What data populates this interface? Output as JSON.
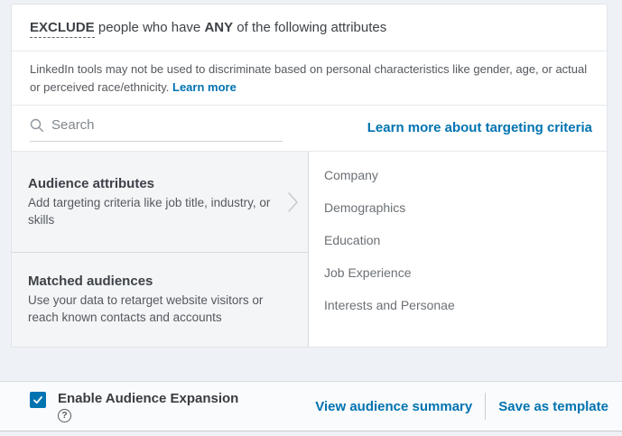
{
  "exclude_header": {
    "exclude": "EXCLUDE",
    "text_mid": " people who have ",
    "any": "ANY",
    "text_end": " of the following attributes"
  },
  "disclaimer": {
    "text": "LinkedIn tools may not be used to discriminate based on personal characteristics like gender, age, or actual or perceived race/ethnicity. ",
    "link": "Learn more"
  },
  "search": {
    "placeholder": "Search",
    "icon": "search-icon"
  },
  "targeting_link": "Learn more about targeting criteria",
  "panels": [
    {
      "title": "Audience attributes",
      "description": "Add targeting criteria like job title, industry, or skills",
      "icon": "chevron-right-icon"
    },
    {
      "title": "Matched audiences",
      "description": "Use your data to retarget website visitors or reach known contacts and accounts"
    }
  ],
  "categories": [
    "Company",
    "Demographics",
    "Education",
    "Job Experience",
    "Interests and Personae"
  ],
  "footer": {
    "checkbox_checked": true,
    "checkbox_label": "Enable Audience Expansion",
    "help_icon": "help-icon",
    "links": [
      "View audience summary",
      "Save as template"
    ]
  },
  "colors": {
    "link_blue": "#0073b1",
    "checkbox_blue": "#0073b1",
    "left_panel_bg": "#f3f5f7",
    "footer_bg": "#fafbfc"
  }
}
